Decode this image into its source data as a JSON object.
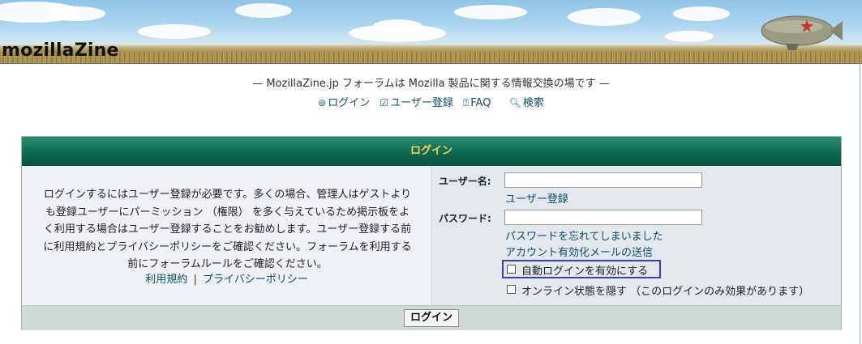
{
  "header": {
    "logo_text": "mozillaZine"
  },
  "tagline": "— MozillaZine.jp フォーラムは Mozilla 製品に関する情報交換の場です —",
  "nav": {
    "items": [
      {
        "icon": "login-icon",
        "label": "ログイン"
      },
      {
        "icon": "register-icon",
        "label": "ユーザー登録"
      },
      {
        "icon": "faq-icon",
        "label": "FAQ"
      },
      {
        "icon": "search-icon",
        "label": "検索"
      }
    ]
  },
  "login_panel": {
    "title": "ログイン",
    "description_lines": [
      "ログインするにはユーザー登録が必要です。多くの場合、管理人はゲストより",
      "も登録ユーザーにパーミッション （権限） を多く与えているため掲示板をよ",
      "く利用する場合はユーザー登録することをお勧めします。ユーザー登録する前",
      "に利用規約とプライバシーポリシーをご確認ください。フォーラムを利用する",
      "前にフォーラムルールをご確認ください。"
    ],
    "terms_link": "利用規約",
    "separator": "|",
    "privacy_link": "プライバシーポリシー",
    "username_label": "ユーザー名:",
    "username_value": "",
    "register_link": "ユーザー登録",
    "password_label": "パスワード:",
    "password_value": "",
    "forgot_password_link": "パスワードを忘れてしまいました",
    "resend_activation_link": "アカウント有効化メールの送信",
    "autologin_label": "自動ログインを有効にする",
    "autologin_checked": false,
    "hide_online_label": "オンライン状態を隠す （このログインのみ効果があります）",
    "hide_online_checked": false,
    "submit_label": "ログイン"
  },
  "colors": {
    "panel_header": "#0c6a52",
    "panel_title": "#ffcf57",
    "link": "#104c6e",
    "highlight_border": "#3a3fb6"
  }
}
